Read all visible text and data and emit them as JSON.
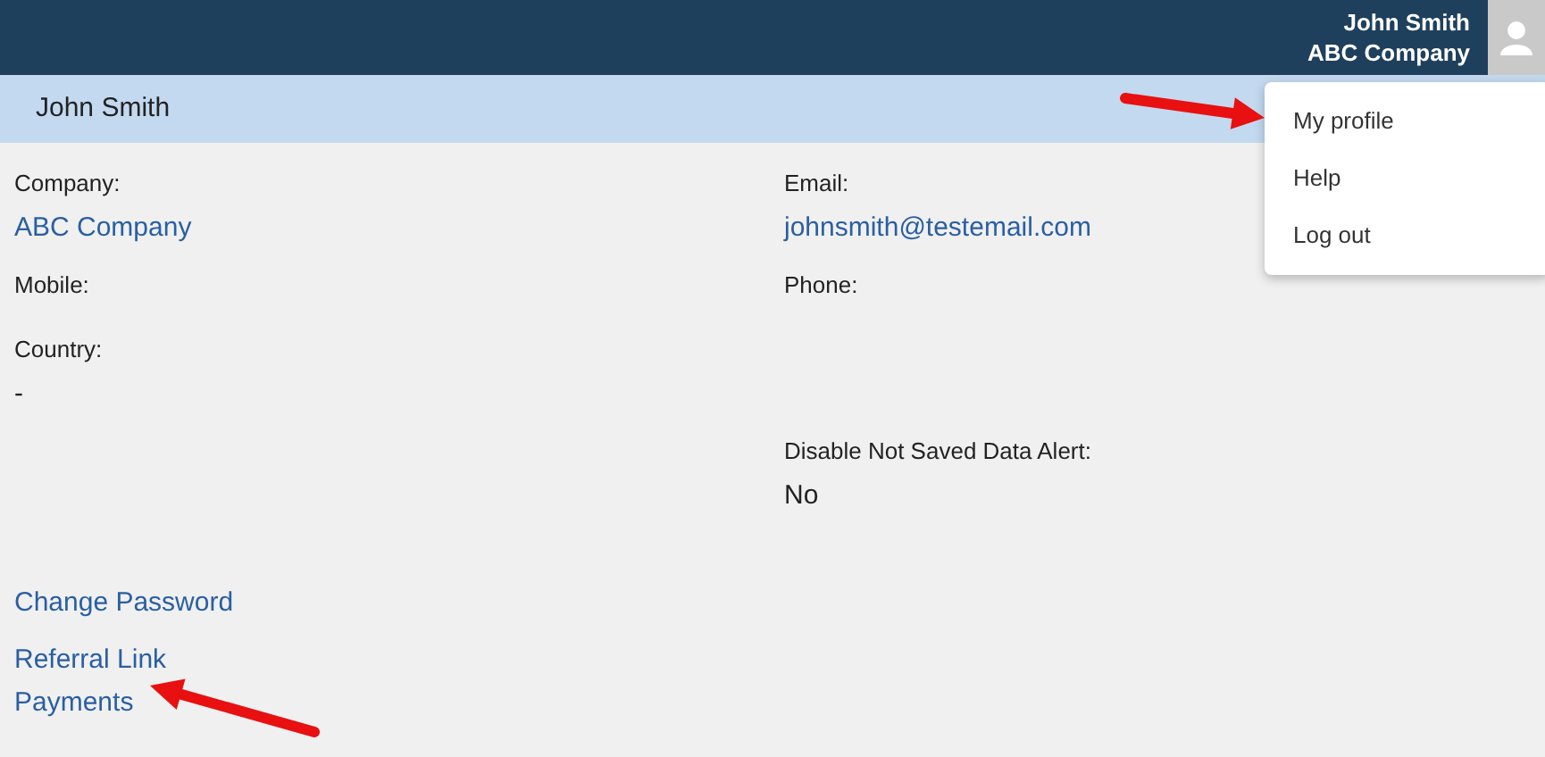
{
  "header": {
    "user_name": "John Smith",
    "company": "ABC Company"
  },
  "user_menu": {
    "items": [
      {
        "label": "My profile"
      },
      {
        "label": "Help"
      },
      {
        "label": "Log out"
      }
    ]
  },
  "banner": {
    "title": "John Smith"
  },
  "left_fields": [
    {
      "label": "Company:",
      "value": "ABC Company",
      "link": true
    },
    {
      "label": "Mobile:"
    },
    {
      "label": "Country:",
      "value": "-",
      "link": false
    }
  ],
  "right_fields": [
    {
      "label": "Email:",
      "value": "johnsmith@testemail.com",
      "link": true
    },
    {
      "label": "Phone:"
    },
    {
      "label": "Disable Not Saved Data Alert:",
      "value": "No",
      "link": false
    }
  ],
  "links": [
    "Change Password",
    "Referral Link",
    "Payments"
  ]
}
